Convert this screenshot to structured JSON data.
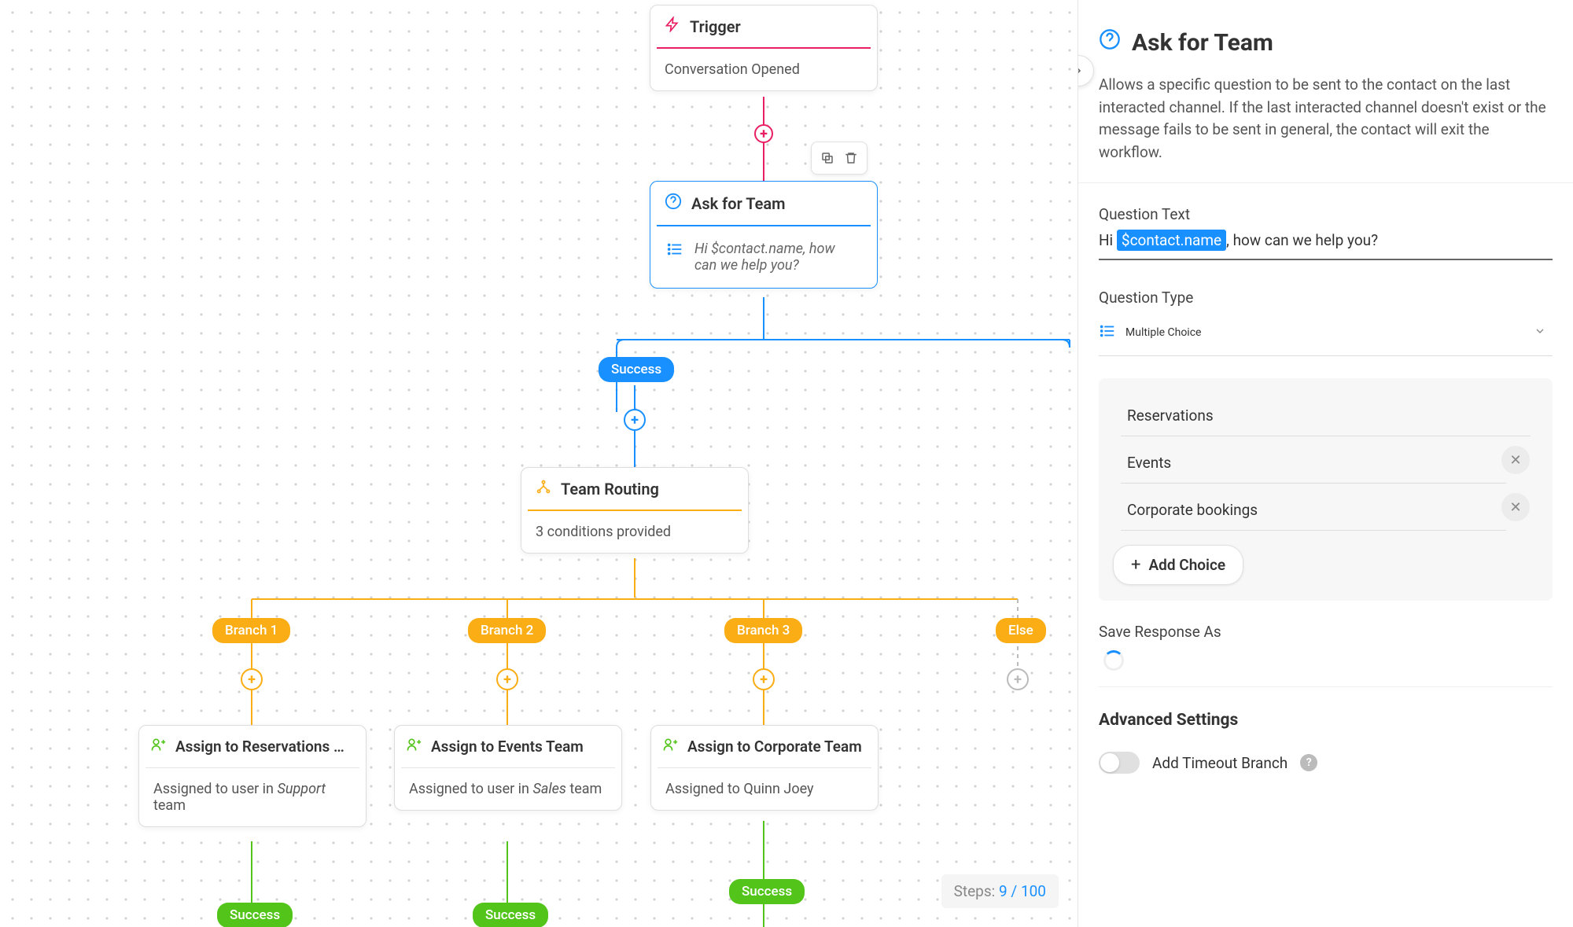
{
  "canvas": {
    "trigger": {
      "title": "Trigger",
      "subtitle": "Conversation Opened"
    },
    "ask": {
      "title": "Ask for Team",
      "question": "Hi $contact.name, how can we help you?"
    },
    "routing": {
      "title": "Team Routing",
      "subtitle": "3 conditions provided"
    },
    "pills": {
      "success": "Success",
      "branch1": "Branch 1",
      "branch2": "Branch 2",
      "branch3": "Branch 3",
      "else": "Else"
    },
    "assign1": {
      "title": "Assign to Reservations …",
      "body_prefix": "Assigned to user in ",
      "body_team": "Support",
      "body_suffix": " team"
    },
    "assign2": {
      "title": "Assign to Events Team",
      "body_prefix": "Assigned to user in ",
      "body_team": "Sales",
      "body_suffix": " team"
    },
    "assign3": {
      "title": "Assign to Corporate Team",
      "body": "Assigned to Quinn Joey"
    },
    "success_green": "Success",
    "steps": {
      "label": "Steps:",
      "current": "9",
      "sep": "/",
      "total": "100"
    }
  },
  "sidebar": {
    "title": "Ask for Team",
    "description": "Allows a specific question to be sent to the contact on the last interacted channel. If the last interacted channel doesn't exist or the message fails to be sent in general, the contact will exit the workflow.",
    "question_text_label": "Question Text",
    "question_text_prefix": "Hi ",
    "question_text_var": "$contact.name",
    "question_text_suffix": ", how can we help you?",
    "question_type_label": "Question Type",
    "question_type_value": "Multiple Choice",
    "choices": {
      "c1": "Reservations",
      "c2": "Events",
      "c3": "Corporate bookings"
    },
    "add_choice": "Add Choice",
    "save_response_label": "Save Response As",
    "advanced_title": "Advanced Settings",
    "timeout_label": "Add Timeout Branch"
  }
}
